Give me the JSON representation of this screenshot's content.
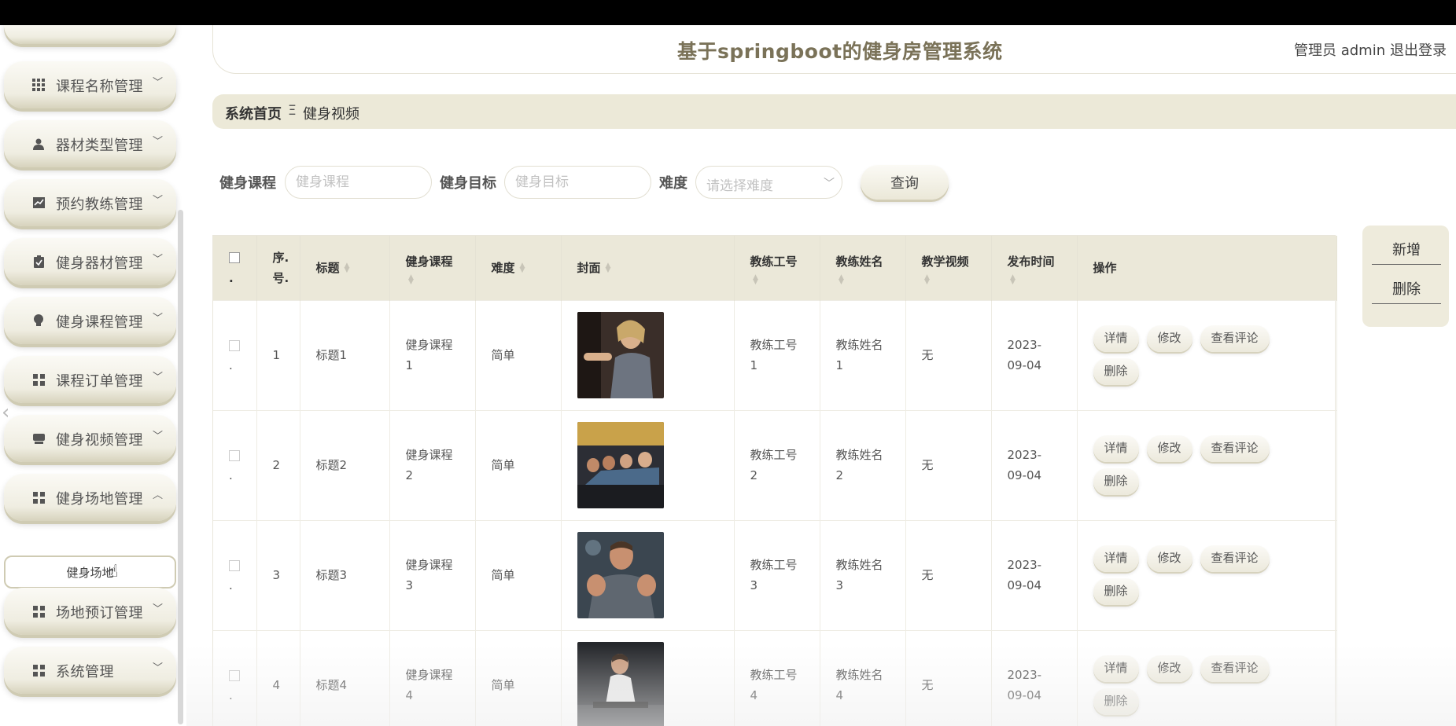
{
  "header": {
    "title": "基于springboot的健身房管理系统",
    "user": "管理员 admin",
    "logout": "退出登录"
  },
  "breadcrumb": {
    "home": "系统首页",
    "separator": "Ξ",
    "current": "健身视频"
  },
  "sidebar": {
    "items": [
      {
        "label": "课程名称管理",
        "icon": "grid-icon"
      },
      {
        "label": "器材类型管理",
        "icon": "user-icon"
      },
      {
        "label": "预约教练管理",
        "icon": "chart-icon"
      },
      {
        "label": "健身器材管理",
        "icon": "clipboard-icon"
      },
      {
        "label": "健身课程管理",
        "icon": "bulb-icon"
      },
      {
        "label": "课程订单管理",
        "icon": "grid-icon"
      },
      {
        "label": "健身视频管理",
        "icon": "inbox-icon"
      },
      {
        "label": "健身场地管理",
        "icon": "grid-icon",
        "expanded": true
      },
      {
        "label": "场地预订管理",
        "icon": "grid-icon"
      },
      {
        "label": "系统管理",
        "icon": "grid-icon"
      }
    ],
    "sub_item": "健身场地"
  },
  "search": {
    "course_label": "健身课程",
    "course_placeholder": "健身课程",
    "goal_label": "健身目标",
    "goal_placeholder": "健身目标",
    "difficulty_label": "难度",
    "difficulty_placeholder": "请选择难度",
    "query_button": "查询"
  },
  "actions": {
    "add": "新增",
    "delete": "删除"
  },
  "table": {
    "columns": {
      "index": "序.号.",
      "title": "标题",
      "course": "健身课程",
      "difficulty": "难度",
      "cover": "封面",
      "coach_id": "教练工号",
      "coach_name": "教练姓名",
      "video": "教学视频",
      "publish_time": "发布时间",
      "ops": "操作"
    },
    "ops": {
      "detail": "详情",
      "edit": "修改",
      "comments": "查看评论",
      "delete": "删除"
    },
    "rows": [
      {
        "index": "1",
        "title": "标题1",
        "course": "健身课程1",
        "difficulty": "简单",
        "coach_id": "教练工号1",
        "coach_name": "教练姓名1",
        "video": "无",
        "time": "2023-09-04"
      },
      {
        "index": "2",
        "title": "标题2",
        "course": "健身课程2",
        "difficulty": "简单",
        "coach_id": "教练工号2",
        "coach_name": "教练姓名2",
        "video": "无",
        "time": "2023-09-04"
      },
      {
        "index": "3",
        "title": "标题3",
        "course": "健身课程3",
        "difficulty": "简单",
        "coach_id": "教练工号3",
        "coach_name": "教练姓名3",
        "video": "无",
        "time": "2023-09-04"
      },
      {
        "index": "4",
        "title": "标题4",
        "course": "健身课程4",
        "difficulty": "简单",
        "coach_id": "教练工号4",
        "coach_name": "教练姓名4",
        "video": "无",
        "time": "2023-09-04"
      }
    ]
  },
  "colors": {
    "accent": "#7a7258",
    "panel": "#ebe8d9",
    "menu_bg": "#efede1"
  }
}
